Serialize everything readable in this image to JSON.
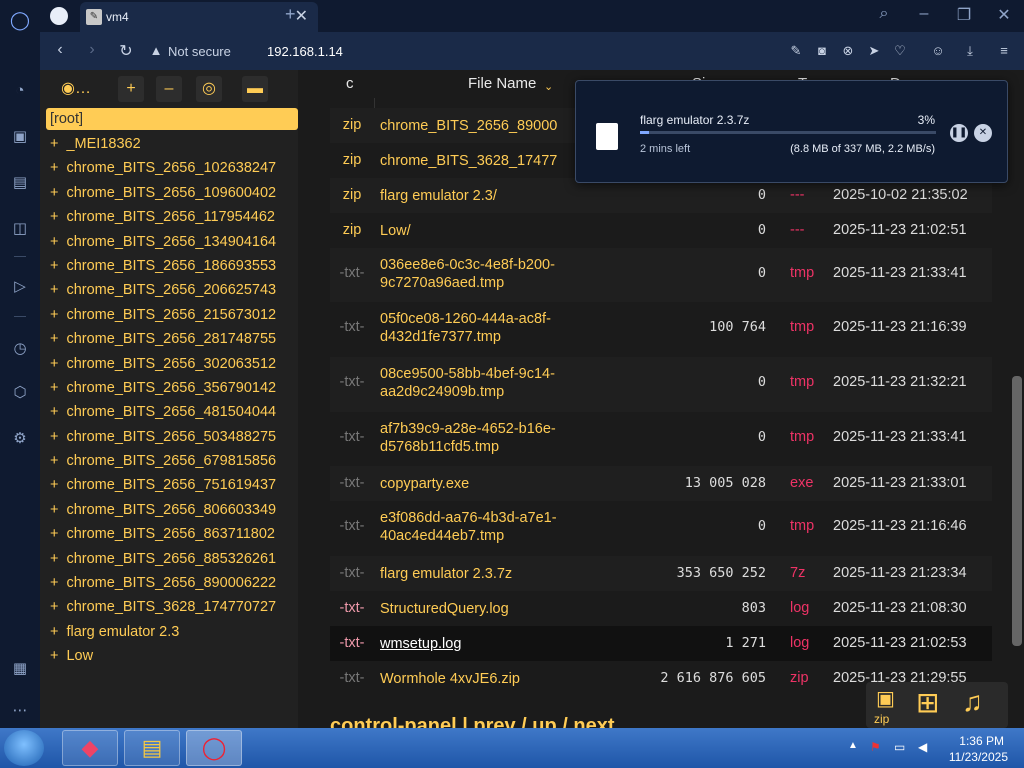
{
  "browser": {
    "tab_title": "vm4",
    "not_secure": "Not secure",
    "url": "192.168.1.14"
  },
  "tree": {
    "root_label": "[root]",
    "items": [
      "_MEI18362",
      "chrome_BITS_2656_102638247",
      "chrome_BITS_2656_109600402",
      "chrome_BITS_2656_117954462",
      "chrome_BITS_2656_134904164",
      "chrome_BITS_2656_186693553",
      "chrome_BITS_2656_206625743",
      "chrome_BITS_2656_215673012",
      "chrome_BITS_2656_281748755",
      "chrome_BITS_2656_302063512",
      "chrome_BITS_2656_356790142",
      "chrome_BITS_2656_481504044",
      "chrome_BITS_2656_503488275",
      "chrome_BITS_2656_679815856",
      "chrome_BITS_2656_751619437",
      "chrome_BITS_2656_806603349",
      "chrome_BITS_2656_863711802",
      "chrome_BITS_2656_885326261",
      "chrome_BITS_2656_890006222",
      "chrome_BITS_3628_174770727",
      "flarg emulator 2.3",
      "Low"
    ]
  },
  "file_table": {
    "headers": {
      "c": "c",
      "name": "File Name",
      "size": "Si",
      "type": "T",
      "date": "Da"
    },
    "rows": [
      {
        "c": "zip",
        "name": "chrome_BITS_2656_89000",
        "size": "",
        "type": "",
        "date": ""
      },
      {
        "c": "zip",
        "name": "chrome_BITS_3628_17477",
        "size": "",
        "type": "",
        "date": ""
      },
      {
        "c": "zip",
        "name": "flarg emulator 2.3/",
        "size": "0",
        "type": "---",
        "date": "2025-10-02 21:35:02"
      },
      {
        "c": "zip",
        "name": "Low/",
        "size": "0",
        "type": "---",
        "date": "2025-11-23 21:02:51"
      },
      {
        "c": "-txt-",
        "name": "036ee8e6-0c3c-4e8f-b200-9c7270a96aed.tmp",
        "size": "0",
        "type": "tmp",
        "date": "2025-11-23 21:33:41"
      },
      {
        "c": "-txt-",
        "name": "05f0ce08-1260-444a-ac8f-d432d1fe7377.tmp",
        "size": "100 764",
        "type": "tmp",
        "date": "2025-11-23 21:16:39"
      },
      {
        "c": "-txt-",
        "name": "08ce9500-58bb-4bef-9c14-aa2d9c24909b.tmp",
        "size": "0",
        "type": "tmp",
        "date": "2025-11-23 21:32:21"
      },
      {
        "c": "-txt-",
        "name": "af7b39c9-a28e-4652-b16e-d5768b11cfd5.tmp",
        "size": "0",
        "type": "tmp",
        "date": "2025-11-23 21:33:41"
      },
      {
        "c": "-txt-",
        "name": "copyparty.exe",
        "size": "13 005 028",
        "type": "exe",
        "date": "2025-11-23 21:33:01"
      },
      {
        "c": "-txt-",
        "name": "e3f086dd-aa76-4b3d-a7e1-40ac4ed44eb7.tmp",
        "size": "0",
        "type": "tmp",
        "date": "2025-11-23 21:16:46"
      },
      {
        "c": "-txt-",
        "name": "flarg emulator 2.3.7z",
        "size": "353 650 252",
        "type": "7z",
        "date": "2025-11-23 21:23:34"
      },
      {
        "c": "-txt-",
        "name": "StructuredQuery.log",
        "size": "803",
        "type": "log",
        "date": "2025-11-23 21:08:30"
      },
      {
        "c": "-txt-",
        "name": "wmsetup.log",
        "size": "1 271",
        "type": "log",
        "date": "2025-11-23 21:02:53"
      },
      {
        "c": "-txt-",
        "name": "Wormhole 4xvJE6.zip",
        "size": "2 616 876 605",
        "type": "zip",
        "date": "2025-11-23 21:29:55"
      }
    ]
  },
  "bottom_nav": "control-panel  |  prev / up / next",
  "media_buttons": {
    "zip_label": "zip"
  },
  "download": {
    "name": "flarg emulator 2.3.7z",
    "percent": "3%",
    "progress": 0.03,
    "time_left": "2 mins left",
    "size_info": "(8.8 MB of 337 MB, 2.2 MB/s)"
  },
  "taskbar": {
    "time": "1:36 PM",
    "date": "11/23/2025"
  }
}
